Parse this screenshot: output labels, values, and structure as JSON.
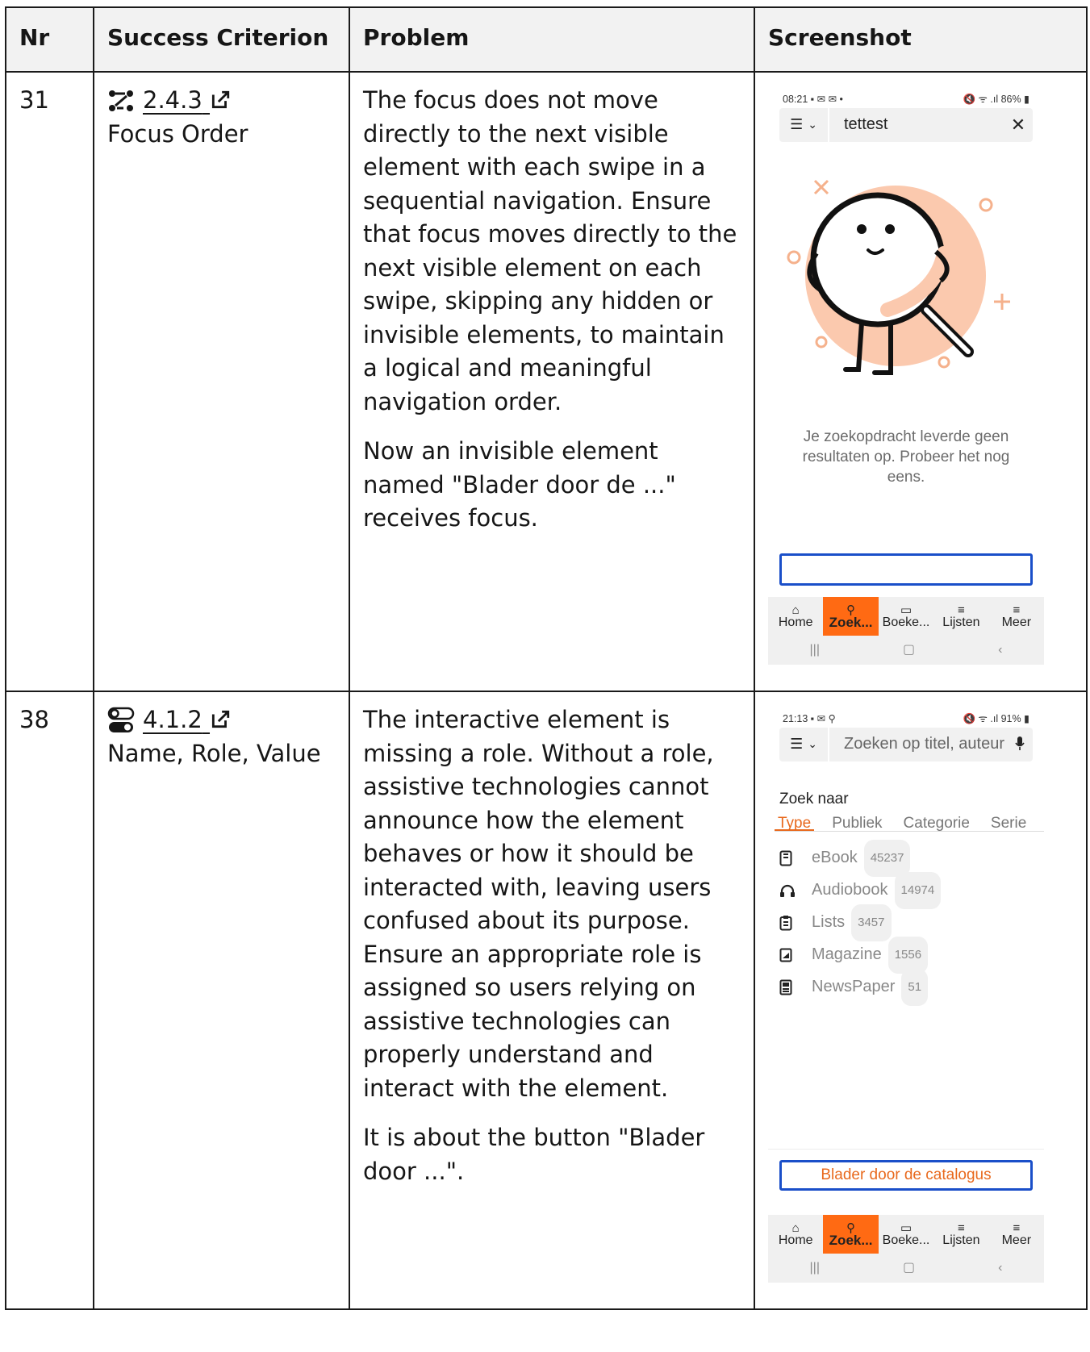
{
  "table": {
    "headers": {
      "nr": "Nr",
      "criterion": "Success Criterion",
      "problem": "Problem",
      "screenshot": "Screenshot"
    },
    "rows": [
      {
        "nr": "31",
        "criterion_number": "2.4.3",
        "criterion_name": "Focus Order",
        "criterion_icon": "focus-order-icon",
        "problem_paragraphs": [
          "The focus does not move directly to the next visible element with each swipe in a sequential navigation. Ensure that focus moves directly to the next visible element on each swipe, skipping any hidden or invisible elements, to maintain a logical and meaningful navigation order.",
          "Now an invisible element named \"Blader door de ...\" receives focus."
        ],
        "screenshot": {
          "status_time": "08:21",
          "status_battery": "86%",
          "search_value": "tettest",
          "empty_message": "Je zoekopdracht leverde geen resultaten op. Probeer het nog eens.",
          "nav": [
            "Home",
            "Zoek...",
            "Boeke...",
            "Lijsten",
            "Meer"
          ],
          "active_nav": "Zoek..."
        }
      },
      {
        "nr": "38",
        "criterion_number": "4.1.2",
        "criterion_name": "Name, Role, Value",
        "criterion_icon": "toggle-icon",
        "problem_paragraphs": [
          "The interactive element is missing a role. Without a role, assistive technologies cannot announce how the element behaves or how it should be interacted with, leaving users confused about its purpose. Ensure an appropriate role is assigned so users relying on assistive technologies can properly understand and interact with the element.",
          "It is about the button \"Blader door ...\"."
        ],
        "screenshot": {
          "status_time": "21:13",
          "status_battery": "91%",
          "search_placeholder": "Zoeken op titel, auteur",
          "zoek_naar": "Zoek naar",
          "filter_tabs": [
            "Type",
            "Publiek",
            "Categorie",
            "Serie"
          ],
          "active_tab": "Type",
          "types": [
            {
              "label": "eBook",
              "count": "45237",
              "icon": "ebook-icon"
            },
            {
              "label": "Audiobook",
              "count": "14974",
              "icon": "headphones-icon"
            },
            {
              "label": "Lists",
              "count": "3457",
              "icon": "clipboard-icon"
            },
            {
              "label": "Magazine",
              "count": "1556",
              "icon": "magazine-icon"
            },
            {
              "label": "NewsPaper",
              "count": "51",
              "icon": "newspaper-icon"
            }
          ],
          "catalog_button": "Blader door de catalogus",
          "nav": [
            "Home",
            "Zoek...",
            "Boeke...",
            "Lijsten",
            "Meer"
          ],
          "active_nav": "Zoek..."
        }
      }
    ]
  },
  "colors": {
    "accent_orange": "#ff6a13",
    "focus_blue": "#1a4fc9",
    "header_bg": "#f2f2f2",
    "mascot_peach": "#fbc9ae"
  }
}
